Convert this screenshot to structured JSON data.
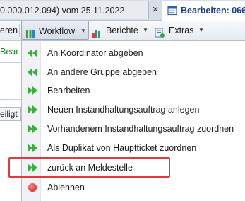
{
  "tabs": {
    "left_tab_title": "0.000.012.094) vom 25.11.2022",
    "close_symbol": "×",
    "active_tab_title": "Bearbeiten: 066."
  },
  "toolbar": {
    "left_fragment": "eren",
    "workflow_label": "Workflow",
    "berichte_label": "Berichte",
    "extras_label": "Extras",
    "caret": "▼"
  },
  "background": {
    "green_fragment": "Bear",
    "field_fragment": "eiligt"
  },
  "menu": {
    "items": [
      {
        "label": "An Koordinator abgeben",
        "icon": "double-arrow-left-icon"
      },
      {
        "label": "An andere Gruppe abgeben",
        "icon": "double-arrow-left-icon"
      },
      {
        "label": "Bearbeiten",
        "icon": "double-arrow-right-icon"
      },
      {
        "label": "Neuen Instandhaltungsauftrag anlegen",
        "icon": "double-arrow-right-icon"
      },
      {
        "label": "Vorhandenem Instandhaltungsauftrag zuordnen",
        "icon": "double-arrow-right-icon"
      },
      {
        "label": "Als Duplikat von Hauptticket zuordnen",
        "icon": "double-arrow-right-icon"
      },
      {
        "label": "zurück an Meldestelle",
        "icon": "double-arrow-right-icon",
        "highlighted": true
      },
      {
        "label": "Ablehnen",
        "icon": "red-circle-icon"
      }
    ]
  },
  "colors": {
    "arrow_green": "#3cae3c",
    "highlight_red": "#e0393e",
    "active_tab_text": "#1f3a93",
    "bg_green_text": "#1f8a2a"
  }
}
